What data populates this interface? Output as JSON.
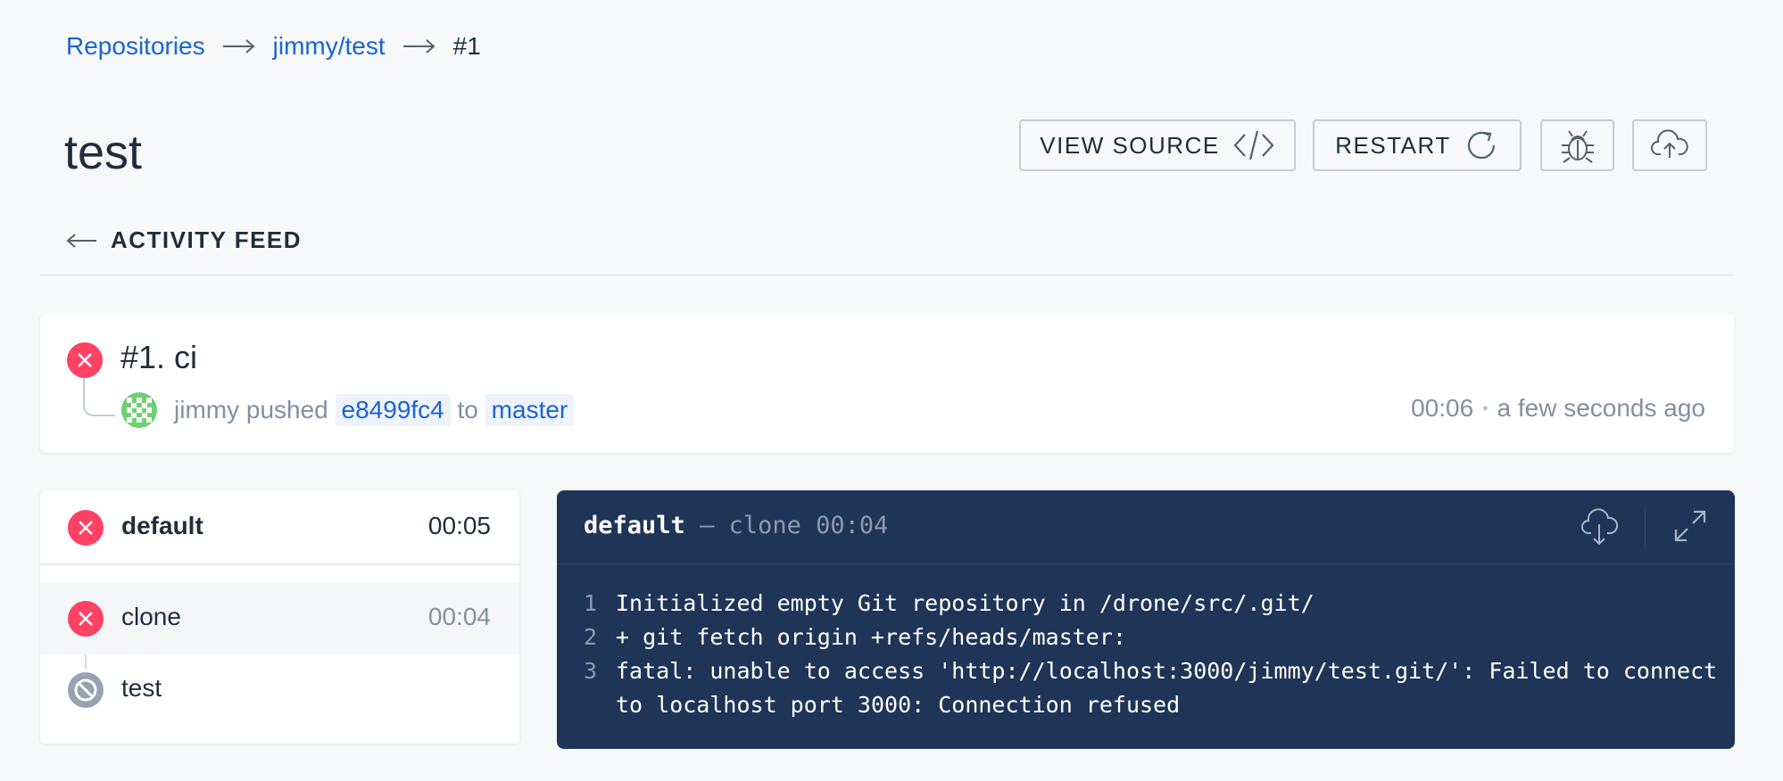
{
  "breadcrumb": {
    "items": [
      "Repositories",
      "jimmy/test",
      "#1"
    ]
  },
  "page": {
    "title": "test"
  },
  "toolbar": {
    "view_source_label": "VIEW SOURCE",
    "restart_label": "RESTART",
    "debug_icon": "bug-icon",
    "promote_icon": "cloud-upload-icon"
  },
  "activity_feed": {
    "label": "ACTIVITY FEED"
  },
  "build": {
    "title": "#1. ci",
    "status": "failure",
    "author": "jimmy",
    "action": "pushed",
    "commit": "e8499fc4",
    "to_word": "to",
    "branch": "master",
    "duration": "00:06",
    "dot": "•",
    "time_ago": "a few seconds ago"
  },
  "stage": {
    "name": "default",
    "duration": "00:05",
    "status": "failure",
    "steps": [
      {
        "name": "clone",
        "duration": "00:04",
        "status": "failure"
      },
      {
        "name": "test",
        "duration": "",
        "status": "skipped"
      }
    ]
  },
  "log": {
    "stage": "default",
    "dash": "—",
    "step": "clone",
    "duration": "00:04",
    "lines": [
      {
        "num": "1",
        "text": "Initialized empty Git repository in /drone/src/.git/"
      },
      {
        "num": "2",
        "text": "+ git fetch origin +refs/heads/master:"
      },
      {
        "num": "3",
        "text": "fatal: unable to access 'http://localhost:3000/jimmy/test.git/': Failed to connect"
      },
      {
        "num": "",
        "text": "to localhost port 3000: Connection refused"
      }
    ]
  },
  "colors": {
    "link": "#1b64d0",
    "failure": "#ff4164",
    "skipped": "#96a2b1",
    "log_bg": "#1f3557"
  }
}
